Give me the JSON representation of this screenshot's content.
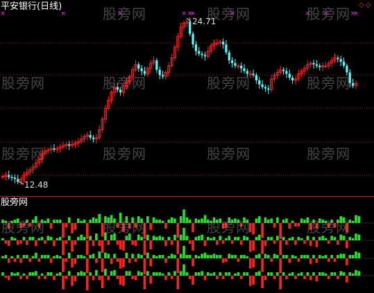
{
  "header": {
    "title": "平安银行(日线)"
  },
  "subchart": {
    "title": "股旁网"
  },
  "watermark": {
    "text": "股旁网"
  },
  "icons": {
    "corner": "◇◇",
    "corner_name": "diamond-icons"
  },
  "colors": {
    "up": "#ff2020",
    "down": "#54ffff",
    "grid": "#8a1f1f",
    "bar_pos": "#28e028",
    "bar_neg": "#ff2020",
    "marker": "#ff20ff"
  },
  "chart_data": [
    {
      "type": "candlestick",
      "title": "平安银行(日线)",
      "ylim": [
        12.2,
        25.2
      ],
      "annotations": [
        {
          "label": "24.71",
          "value": 24.71,
          "index": 61
        },
        {
          "label": "12.48",
          "value": 12.48,
          "index": 5
        }
      ],
      "markers": [
        {
          "symbol": "×",
          "index": 0
        },
        {
          "symbol": "×",
          "index": 20
        },
        {
          "symbol": "×",
          "index": 39
        },
        {
          "symbol": "×",
          "index": 60
        },
        {
          "symbol": "×",
          "index": 62
        },
        {
          "symbol": "×",
          "index": 63
        },
        {
          "symbol": "×",
          "index": 76
        },
        {
          "symbol": "×",
          "index": 101
        },
        {
          "symbol": "×",
          "index": 107
        },
        {
          "symbol": "×",
          "index": 116
        },
        {
          "symbol": "×",
          "index": 117
        },
        {
          "symbol": "×",
          "index": 125
        }
      ],
      "series": [
        {
          "values": [
            12.9,
            13.0,
            12.85,
            12.8,
            12.7,
            12.48,
            12.7,
            13.0,
            13.2,
            13.4,
            13.6,
            13.9,
            14.2,
            14.6,
            14.8,
            14.9,
            15.0,
            14.9,
            15.0,
            15.1,
            15.2,
            15.3,
            15.2,
            15.3,
            15.4,
            15.5,
            15.7,
            15.9,
            16.0,
            15.8,
            15.7,
            15.8,
            16.4,
            17.2,
            18.0,
            18.6,
            19.2,
            19.6,
            19.4,
            19.2,
            19.6,
            20.0,
            20.4,
            20.9,
            21.3,
            21.0,
            20.8,
            20.6,
            21.0,
            21.4,
            21.6,
            20.9,
            20.5,
            20.4,
            20.7,
            21.2,
            21.8,
            22.6,
            23.4,
            24.1,
            24.4,
            24.5,
            23.6,
            22.8,
            22.3,
            22.1,
            22.0,
            21.9,
            22.3,
            22.7,
            22.9,
            22.9,
            23.0,
            22.8,
            22.2,
            21.6,
            21.4,
            21.2,
            21.2,
            21.0,
            20.8,
            20.6,
            20.6,
            20.5,
            20.1,
            19.8,
            19.6,
            19.5,
            19.4,
            20.2,
            20.5,
            20.7,
            20.9,
            20.8,
            20.6,
            20.3,
            20.1,
            20.2,
            20.6,
            20.8,
            21.0,
            21.3,
            21.4,
            21.3,
            21.2,
            21.1,
            21.2,
            21.2,
            21.4,
            21.6,
            21.8,
            21.7,
            21.5,
            21.2,
            20.7,
            19.9,
            19.7,
            19.9
          ]
        }
      ]
    },
    {
      "type": "bar",
      "title": "股旁网",
      "ylim": [
        -1.4,
        1.4
      ],
      "series": [
        {
          "values": [
            0.3,
            0.2,
            -0.5,
            0.2,
            0.3,
            0.4,
            -0.4,
            -0.3,
            0.3,
            -0.3,
            0.3,
            0.6,
            -0.4,
            0.3,
            0.2,
            0.4,
            -0.5,
            0.3,
            0.3,
            0.3,
            -1.3,
            -0.4,
            0.5,
            -0.9,
            -0.6,
            0.4,
            0.2,
            0.3,
            -1.4,
            0.3,
            0.5,
            0.4,
            0.8,
            -1.2,
            0.6,
            0.5,
            0.7,
            0.4,
            -0.4,
            0.9,
            -0.8,
            0.6,
            -0.5,
            0.5,
            -0.4,
            0.6,
            0.4,
            -1.4,
            0.6,
            -0.6,
            0.5,
            0.3,
            0.3,
            0.2,
            -0.5,
            0.3,
            0.5,
            0.4,
            -1.3,
            0.6,
            1.2,
            0.5,
            0.3,
            -0.8,
            0.4,
            0.3,
            0.4,
            0.7,
            0.3,
            0.2,
            0.5,
            0.3,
            0.4,
            -0.5,
            -0.4,
            0.5,
            0.3,
            0.4,
            0.3,
            -0.3,
            0.5,
            0.3,
            -0.8,
            -1.0,
            0.4,
            0.6,
            -1.3,
            0.5,
            0.3,
            0.4,
            -0.4,
            0.5,
            -1.4,
            0.3,
            0.4,
            -0.5,
            0.2,
            -0.3,
            -0.3,
            0.4,
            0.3,
            0.5,
            -0.6,
            0.3,
            -0.5,
            0.4,
            0.3,
            0.2,
            -0.4,
            0.3,
            -0.4,
            0.3,
            0.6,
            0.5,
            -0.8,
            0.3,
            0.2,
            0.7,
            0.6
          ]
        },
        {
          "values": [
            0.2,
            -0.3,
            -0.5,
            0.3,
            0.2,
            -0.4,
            -0.3,
            0.3,
            -0.4,
            0.3,
            0.3,
            -0.5,
            0.2,
            0.3,
            -0.3,
            0.4,
            0.3,
            -0.5,
            0.2,
            0.3,
            -1.3,
            -0.3,
            0.4,
            -1.0,
            -0.4,
            0.3,
            0.5,
            0.3,
            -1.3,
            0.4,
            -0.5,
            0.6,
            -0.5,
            -1.1,
            0.7,
            -0.4,
            0.5,
            0.6,
            -0.4,
            -0.8,
            -0.9,
            0.4,
            0.6,
            -0.4,
            -0.5,
            0.5,
            0.3,
            -1.3,
            0.5,
            -0.8,
            0.4,
            0.3,
            0.4,
            0.3,
            -0.5,
            0.3,
            -0.4,
            0.5,
            -1.2,
            0.5,
            1.1,
            0.4,
            -0.3,
            -0.9,
            0.3,
            0.4,
            0.5,
            -0.5,
            0.3,
            0.2,
            0.3,
            -0.4,
            0.4,
            -0.3,
            0.2,
            0.4,
            -0.3,
            0.3,
            0.3,
            -0.4,
            0.4,
            0.3,
            -1.0,
            -0.9,
            0.3,
            0.5,
            -1.2,
            -0.5,
            0.3,
            0.3,
            -0.3,
            0.4,
            -1.3,
            0.3,
            -0.4,
            0.2,
            0.3,
            -0.4,
            0.3,
            0.2,
            -0.3,
            0.4,
            -0.5,
            0.3,
            -0.6,
            0.3,
            0.4,
            0.2,
            -0.3,
            0.4,
            0.3,
            -0.4,
            0.5,
            0.4,
            -0.7,
            0.3,
            0.2,
            0.6,
            0.5
          ]
        },
        {
          "values": [
            0.2,
            0.3,
            -0.4,
            0.2,
            -0.3,
            0.3,
            -0.4,
            0.3,
            0.3,
            -0.3,
            0.2,
            0.5,
            -0.3,
            0.3,
            0.3,
            0.3,
            -0.4,
            0.2,
            0.3,
            0.2,
            -1.2,
            -0.3,
            0.5,
            -0.8,
            -0.5,
            0.3,
            0.3,
            0.2,
            -1.3,
            0.3,
            0.4,
            -0.4,
            0.6,
            -1.2,
            0.5,
            0.4,
            -0.5,
            0.4,
            -0.3,
            -0.9,
            -0.8,
            0.5,
            -0.4,
            0.4,
            -0.3,
            0.4,
            0.3,
            -1.4,
            0.5,
            -0.7,
            0.3,
            0.2,
            0.3,
            0.3,
            -0.4,
            0.2,
            0.4,
            0.3,
            -1.3,
            0.4,
            1.1,
            0.3,
            0.3,
            -0.7,
            0.3,
            0.2,
            0.4,
            0.5,
            0.3,
            0.3,
            0.4,
            0.3,
            0.3,
            -0.4,
            -0.3,
            0.4,
            0.3,
            0.3,
            -0.3,
            0.3,
            0.3,
            0.2,
            -0.9,
            -0.8,
            0.3,
            0.4,
            -1.2,
            0.4,
            0.3,
            -0.3,
            0.4,
            0.3,
            -1.3,
            0.3,
            0.3,
            -0.4,
            0.3,
            0.2,
            -0.3,
            0.3,
            0.3,
            0.3,
            -0.5,
            0.3,
            -0.4,
            0.3,
            0.2,
            0.3,
            -0.3,
            0.3,
            -0.3,
            0.3,
            0.4,
            0.4,
            -0.6,
            0.3,
            0.3,
            0.6,
            0.5
          ]
        },
        {
          "values": [
            0.3,
            -0.2,
            -0.4,
            0.3,
            0.2,
            0.3,
            -0.3,
            0.2,
            -0.3,
            0.3,
            0.3,
            0.4,
            -0.3,
            0.2,
            -0.3,
            0.3,
            0.3,
            -0.4,
            0.2,
            0.3,
            -1.2,
            -0.3,
            0.4,
            -0.9,
            -0.5,
            0.3,
            0.4,
            0.3,
            -1.3,
            0.3,
            -0.4,
            0.5,
            -0.4,
            -1.1,
            0.6,
            -0.4,
            0.4,
            0.5,
            -0.3,
            -0.8,
            -0.9,
            0.4,
            0.4,
            -0.3,
            -0.4,
            0.4,
            0.3,
            -1.2,
            0.4,
            -0.7,
            0.3,
            0.3,
            0.3,
            0.2,
            -0.4,
            0.3,
            -0.3,
            0.4,
            -1.2,
            0.4,
            1.0,
            0.3,
            -0.3,
            -0.8,
            0.3,
            0.3,
            0.4,
            -0.4,
            0.3,
            0.2,
            0.3,
            -0.3,
            0.3,
            -0.3,
            0.3,
            0.3,
            -0.3,
            0.2,
            0.3,
            -0.3,
            0.3,
            0.3,
            -0.9,
            -0.8,
            0.3,
            0.4,
            -1.1,
            -0.4,
            0.3,
            0.3,
            -0.3,
            0.3,
            -1.2,
            0.3,
            -0.3,
            0.2,
            0.3,
            -0.3,
            0.2,
            0.3,
            -0.3,
            0.3,
            -0.4,
            0.3,
            -0.5,
            0.3,
            0.3,
            0.2,
            -0.3,
            0.3,
            0.3,
            -0.3,
            0.4,
            0.3,
            -0.6,
            0.3,
            0.2,
            0.5,
            0.4
          ]
        }
      ]
    }
  ]
}
